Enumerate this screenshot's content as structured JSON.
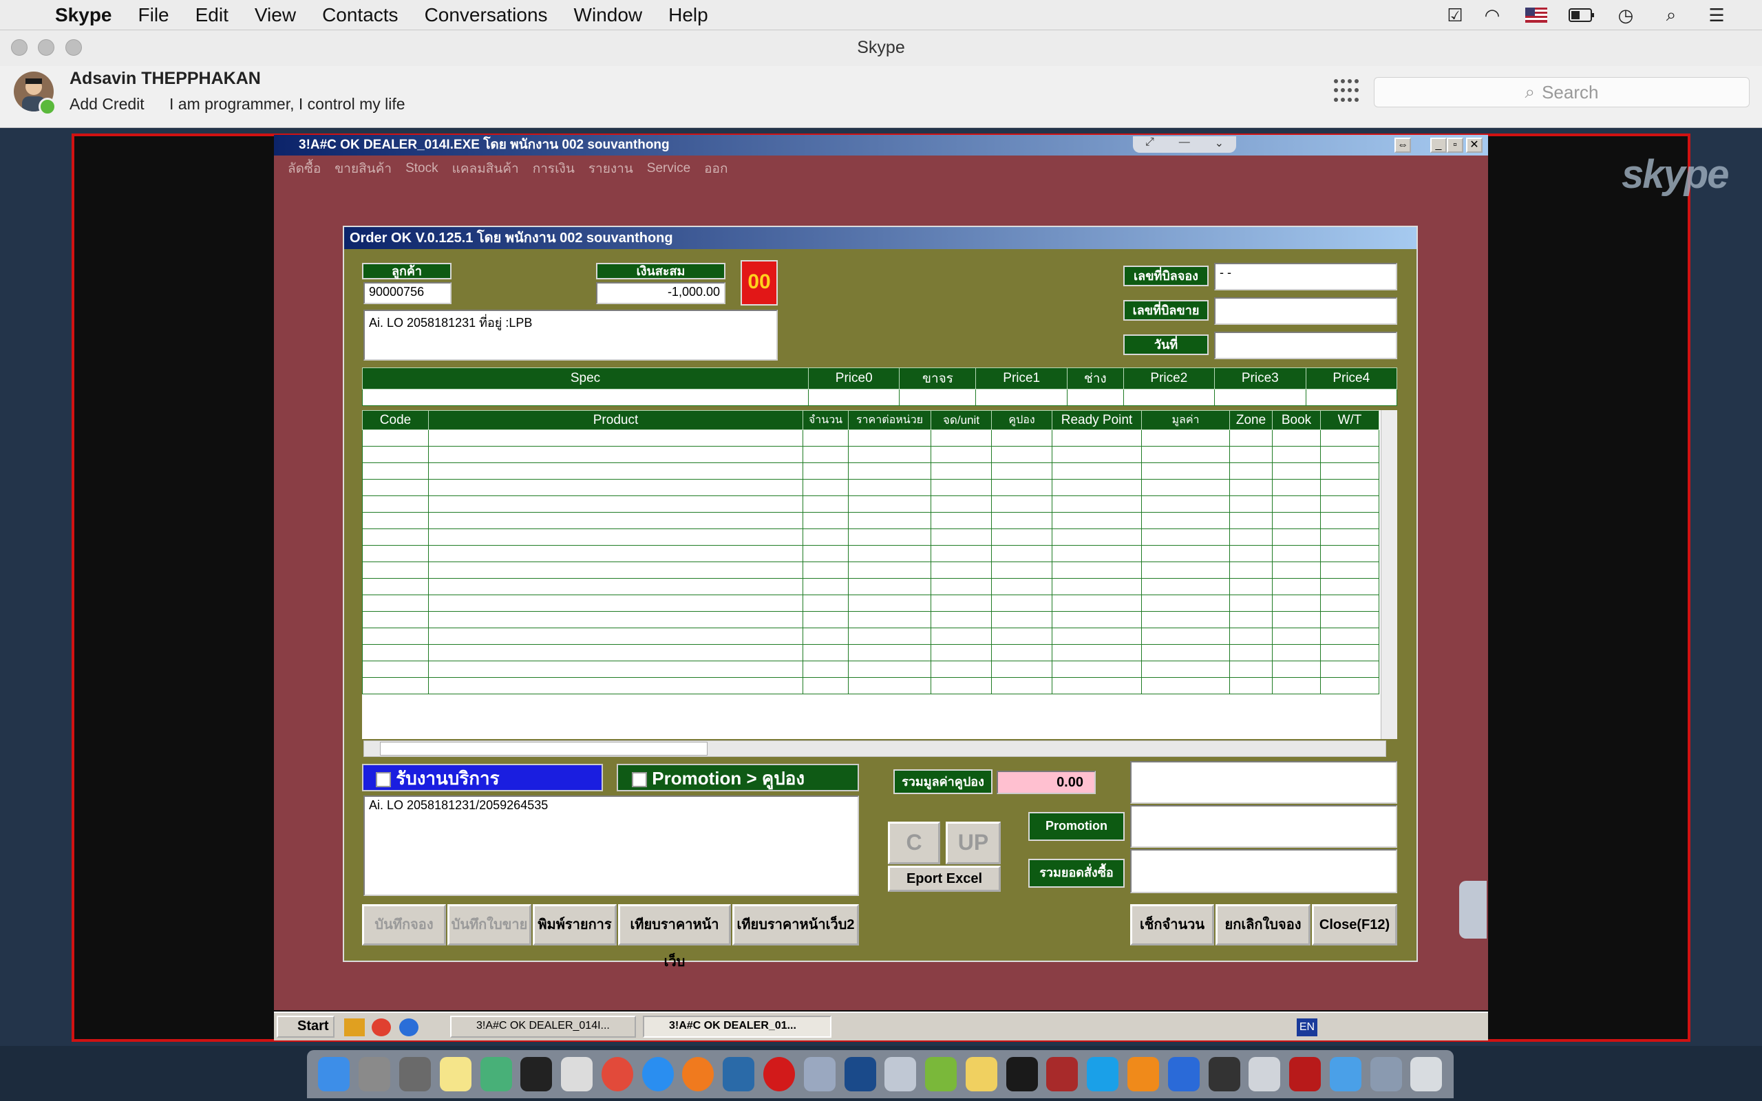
{
  "menubar": {
    "app": "Skype",
    "items": [
      "File",
      "Edit",
      "View",
      "Contacts",
      "Conversations",
      "Window",
      "Help"
    ]
  },
  "window": {
    "title": "Skype"
  },
  "profile": {
    "name": "Adsavin THEPPHAKAN",
    "add_credit": "Add Credit",
    "mood": "I am programmer, I control my life"
  },
  "search": {
    "placeholder": "Search"
  },
  "watermark": "skype",
  "app": {
    "title": "3!A#C OK DEALER_014I.EXE โดย พนักงาน 002 souvanthong",
    "menu": [
      "ลัดซื้อ",
      "ขายสินค้า",
      "Stock",
      "แคลมสินค้า",
      "การเงิน",
      "รายงาน",
      "Service",
      "ออก"
    ]
  },
  "dialog": {
    "title": "Order OK V.0.125.1 โดย พนักงาน 002 souvanthong",
    "customer_label": "ลูกค้า",
    "customer_code": "90000756",
    "balance_label": "เงินสะสม",
    "balance_value": "-1,000.00",
    "badge": "00",
    "address": "Ai. LO 2058181231 ที่อยู่ :LPB",
    "reserve_label": "เลขที่บิลจอง",
    "reserve_value": "-  -",
    "sale_label": "เลขที่บิลขาย",
    "date_label": "วันที่",
    "spec_headers": [
      "Spec",
      "Price0",
      "ขาจร",
      "Price1",
      "ช่าง",
      "Price2",
      "Price3",
      "Price4"
    ],
    "grid_headers": [
      "Code",
      "Product",
      "จำนวน",
      "ราคาต่อหน่วย",
      "จด/unit",
      "คูปอง",
      "Ready Point",
      "มูลค่า",
      "Zone",
      "Book",
      "W/T"
    ],
    "service_check": "รับงานบริการ",
    "promo_check": "Promotion > คูปอง",
    "coupon_total_label": "รวมมูลค่าคูปอง",
    "coupon_total_value": "0.00",
    "note": "Ai. LO 2058181231/2059264535",
    "btn_c": "C",
    "btn_up": "UP",
    "btn_export": "Eport Excel",
    "promotion_label": "Promotion",
    "order_total_label": "รวมยอดสั่งซื้อ",
    "bottom_buttons": [
      "บันทึกจอง",
      "บันทึกใบขาย",
      "พิมพ์รายการ",
      "เทียบราคาหน้าเว็บ",
      "เทียบราคาหน้าเว็บ2"
    ],
    "right_buttons": [
      "เช็กจำนวน",
      "ยกเลิกใบจอง",
      "Close(F12)"
    ]
  },
  "taskbar": {
    "start": "Start",
    "task1": "3!A#C OK DEALER_014I...",
    "task2": "3!A#C OK DEALER_01...",
    "lang": "EN"
  }
}
